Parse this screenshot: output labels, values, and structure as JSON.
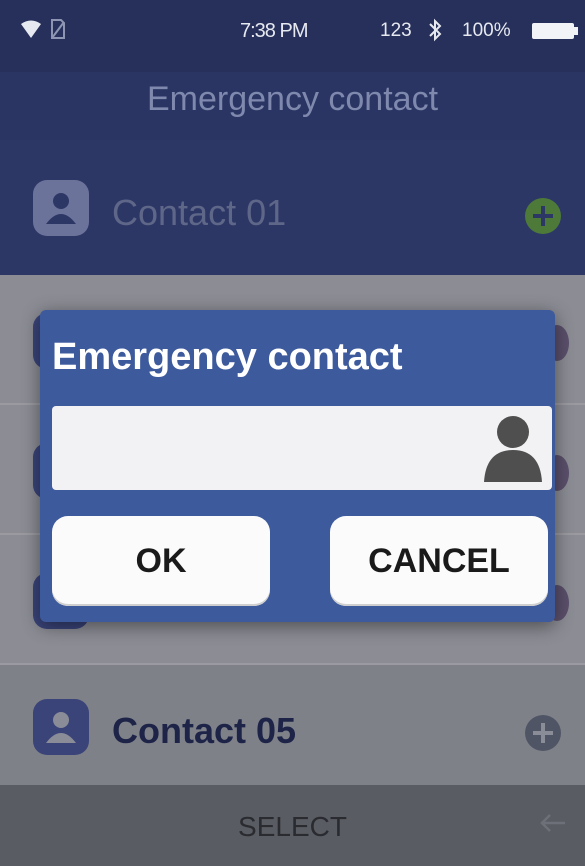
{
  "status_bar": {
    "time": "7:38 PM",
    "network": "123",
    "battery": "100%",
    "icons": [
      "wifi-icon",
      "no-sim-icon",
      "bluetooth-icon",
      "battery-icon"
    ]
  },
  "app": {
    "title": "Emergency contact"
  },
  "contacts": {
    "first_label": "Contact 01",
    "last_label": "Contact 05"
  },
  "dialog": {
    "title": "Emergency contact",
    "input_value": "",
    "ok_label": "OK",
    "cancel_label": "CANCEL"
  },
  "softkeys": {
    "select_label": "SELECT"
  },
  "colors": {
    "header_bg": "#26305a",
    "dialog_bg": "#3d5a9c",
    "add_active": "#4d7a38"
  }
}
